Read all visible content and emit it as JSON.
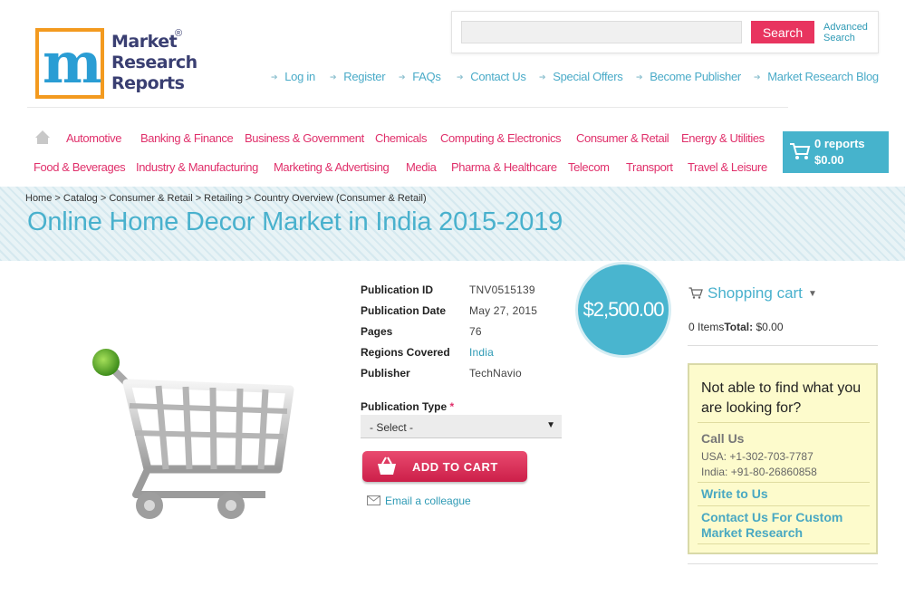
{
  "logo": {
    "line1": "Market",
    "line2": "Research",
    "line3": "Reports",
    "reg": "®",
    "letter_m": "m"
  },
  "search": {
    "placeholder": "",
    "button": "Search",
    "advanced_line1": "Advanced",
    "advanced_line2": "Search"
  },
  "top_nav": [
    "Log in",
    "Register",
    "FAQs",
    "Contact Us",
    "Special Offers",
    "Become Publisher",
    "Market Research Blog"
  ],
  "categories_row1": [
    "Automotive",
    "Banking & Finance",
    "Business & Government",
    "Chemicals",
    "Computing & Electronics",
    "Consumer & Retail",
    "Energy & Utilities"
  ],
  "categories_row2": [
    "Food & Beverages",
    "Industry & Manufacturing",
    "Marketing & Advertising",
    "Media",
    "Pharma & Healthcare",
    "Telecom",
    "Transport",
    "Travel & Leisure"
  ],
  "cart": {
    "reports": "0 reports",
    "total": "$0.00"
  },
  "breadcrumb": "Home > Catalog > Consumer & Retail > Retailing > Country Overview (Consumer & Retail)",
  "title": "Online Home Decor Market in India 2015-2019",
  "details": [
    {
      "label": "Publication ID",
      "value": "TNV0515139"
    },
    {
      "label": "Publication Date",
      "value": "May 27, 2015"
    },
    {
      "label": "Pages",
      "value": "76"
    },
    {
      "label": "Regions Covered",
      "value": "India"
    },
    {
      "label": "Publisher",
      "value": "TechNavio"
    }
  ],
  "price": "$2,500.00",
  "publication_type": {
    "label": "Publication Type",
    "required_mark": "*",
    "selected": "- Select -"
  },
  "add_to_cart": "ADD TO CART",
  "email_colleague": "Email a colleague",
  "shopping_cart": {
    "title": "Shopping cart",
    "items": "0 Items",
    "total_label": "Total:",
    "total_value": "$0.00"
  },
  "help": {
    "question": "Not able to find what you are looking for?",
    "call_us": "Call Us",
    "usa": "USA: +1-302-703-7787",
    "india": "India: +91-80-26860858",
    "write_to_us": "Write to Us",
    "custom": "Contact Us For Custom Market Research"
  },
  "colors": {
    "accent": "#49b1cd",
    "brand_pink": "#e0306b",
    "cart_bg": "#46b3cc",
    "help_bg": "#fdfbcc"
  }
}
